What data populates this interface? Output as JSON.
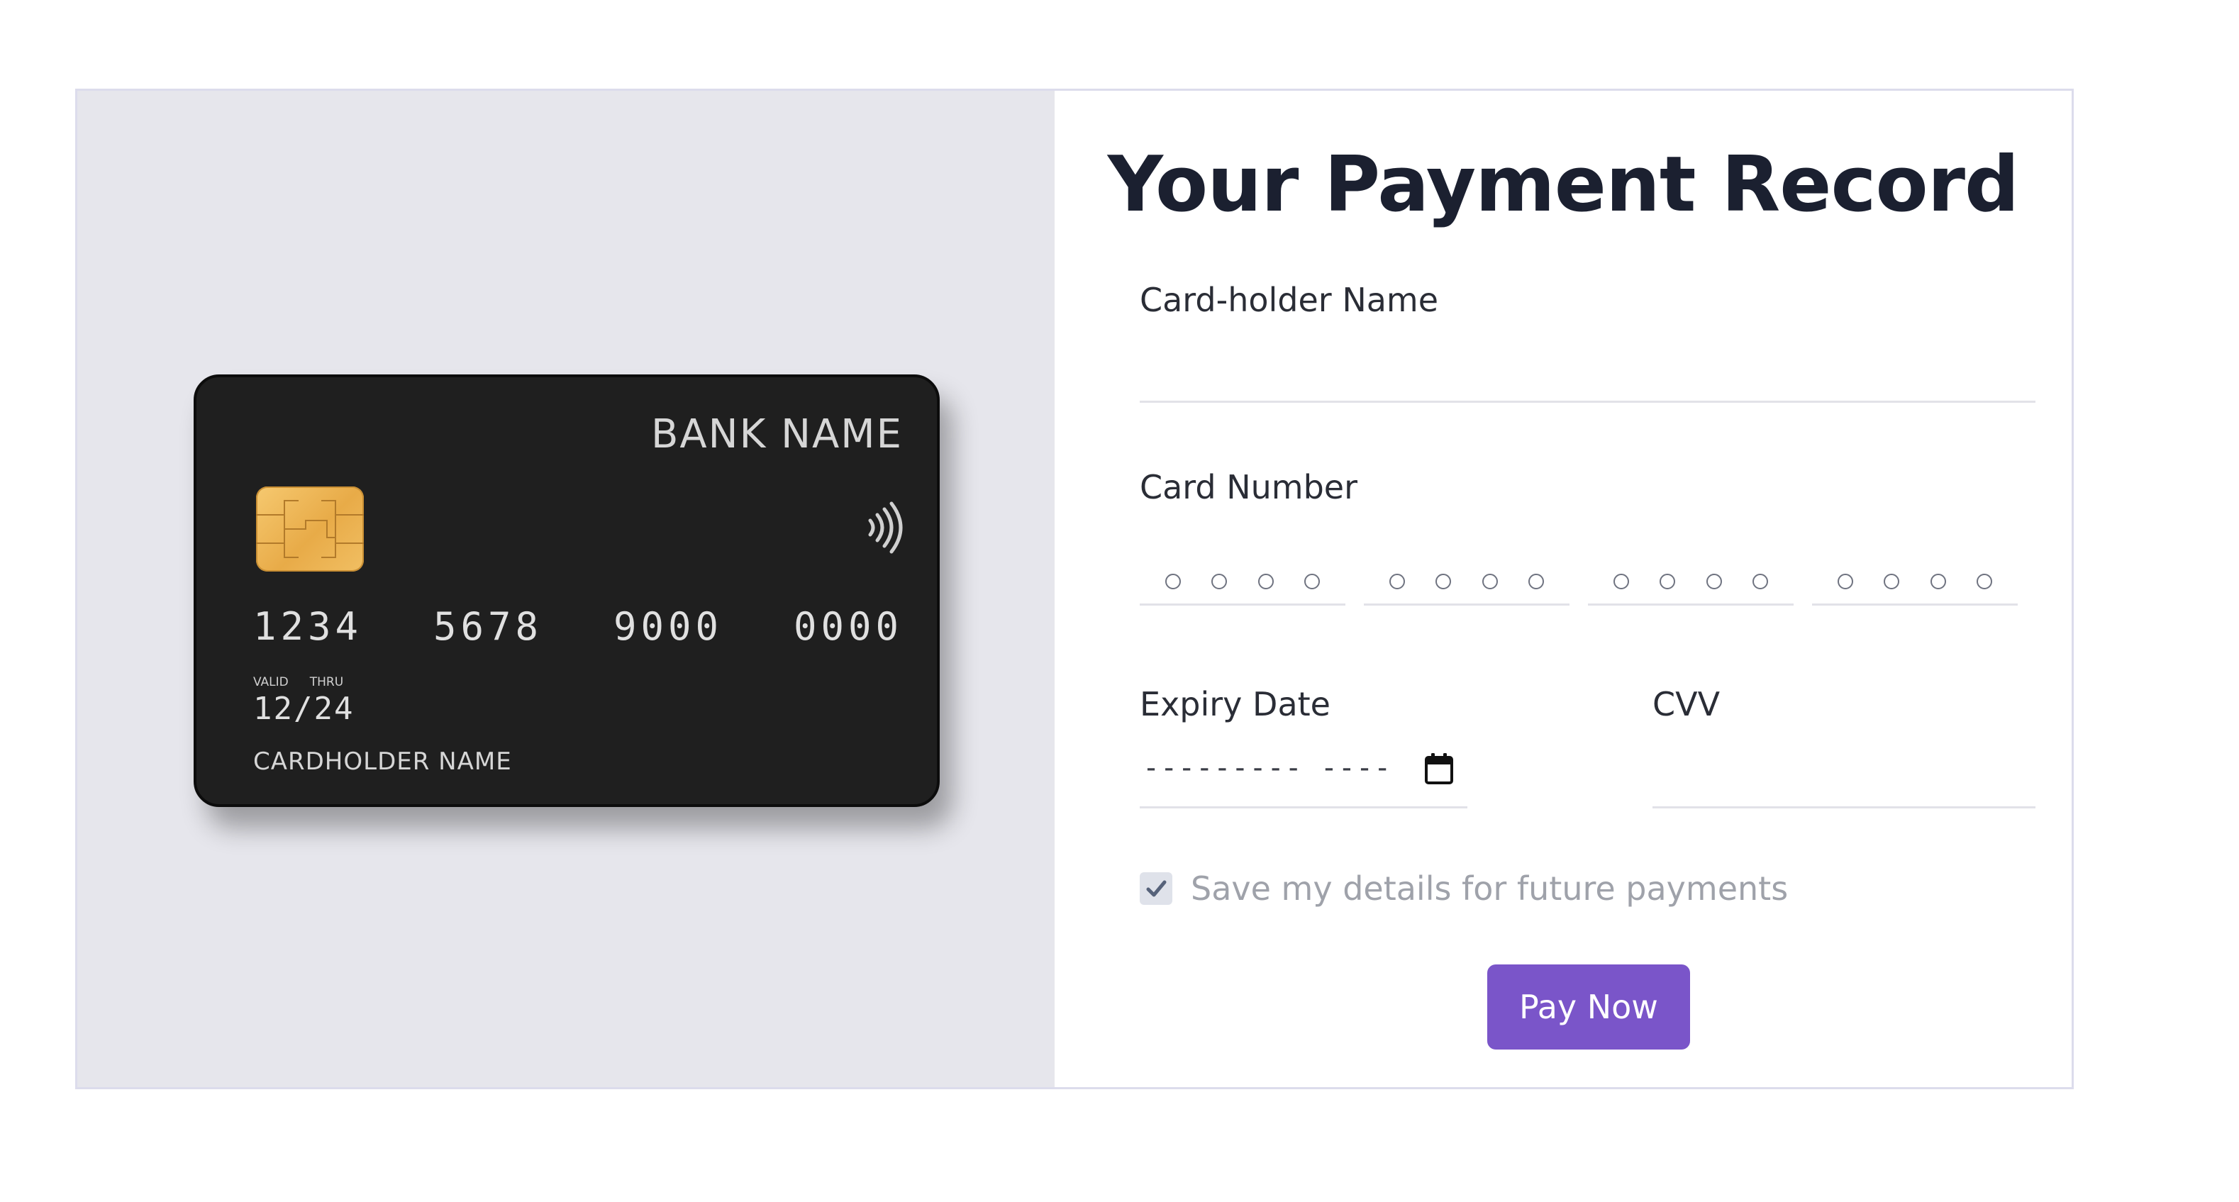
{
  "card": {
    "bank_name": "BANK NAME",
    "number_groups": [
      "1234",
      "5678",
      "9000",
      "0000"
    ],
    "valid_label": "VALID",
    "thru_label": "THRU",
    "expiry": "12/24",
    "holder_name": "CARDHOLDER NAME",
    "chip_icon": "chip-icon",
    "contactless_icon": "contactless-icon"
  },
  "form": {
    "title": "Your Payment Record",
    "cardholder_label": "Card-holder Name",
    "cardholder_value": "",
    "card_number_label": "Card Number",
    "expiry_label": "Expiry Date",
    "expiry_placeholder": "--------- ----",
    "cvv_label": "CVV",
    "cvv_value": "",
    "save_label": "Save my details for future payments",
    "save_checked": true,
    "pay_button_label": "Pay Now",
    "calendar_icon": "calendar-icon"
  },
  "colors": {
    "left_panel": "#e6e6ec",
    "card_body": "#1f1f1f",
    "chip_gold": "#f0b957",
    "title_text": "#1b2030",
    "accent_button": "#7a55c9",
    "muted_text": "#9fa2aa"
  }
}
